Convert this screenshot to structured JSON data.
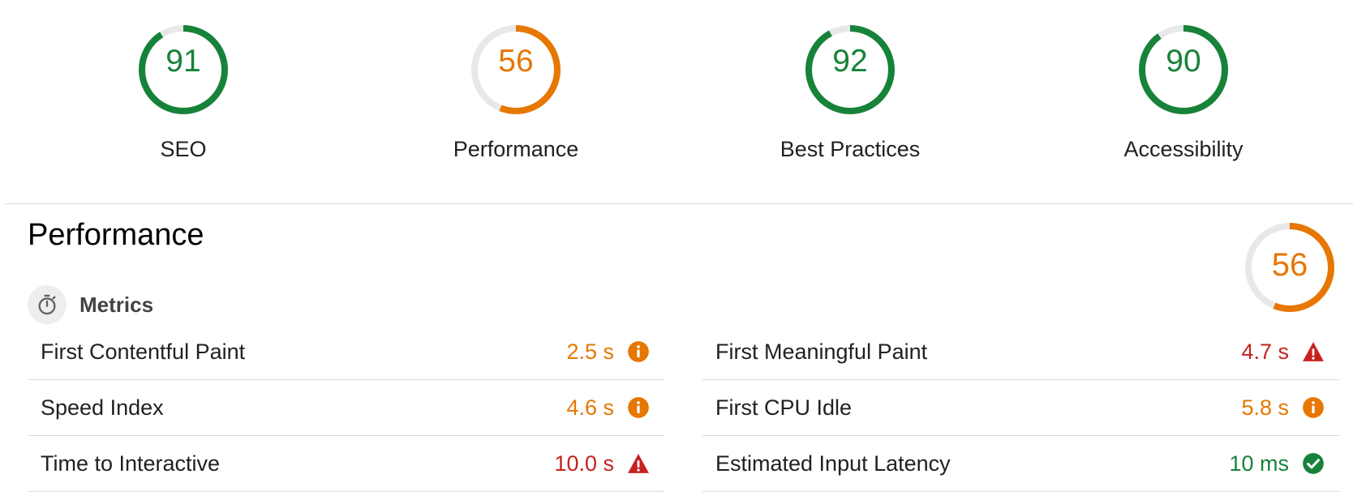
{
  "colors": {
    "pass": "#178239",
    "average": "#e67700",
    "fail": "#c7221f",
    "track": "#e8e8e8"
  },
  "summary_gauges": [
    {
      "label": "SEO",
      "score": "91",
      "fraction": 0.91,
      "status": "pass"
    },
    {
      "label": "Performance",
      "score": "56",
      "fraction": 0.56,
      "status": "average"
    },
    {
      "label": "Best Practices",
      "score": "92",
      "fraction": 0.92,
      "status": "pass"
    },
    {
      "label": "Accessibility",
      "score": "90",
      "fraction": 0.9,
      "status": "pass"
    }
  ],
  "performance": {
    "title": "Performance",
    "score": "56",
    "fraction": 0.56,
    "status": "average",
    "metrics_title": "Metrics",
    "metrics_icon": "stopwatch-icon",
    "metrics": [
      {
        "name": "First Contentful Paint",
        "value": "2.5 s",
        "status": "average",
        "icon": "info-icon"
      },
      {
        "name": "First Meaningful Paint",
        "value": "4.7 s",
        "status": "fail",
        "icon": "warning-triangle-icon"
      },
      {
        "name": "Speed Index",
        "value": "4.6 s",
        "status": "average",
        "icon": "info-icon"
      },
      {
        "name": "First CPU Idle",
        "value": "5.8 s",
        "status": "average",
        "icon": "info-icon"
      },
      {
        "name": "Time to Interactive",
        "value": "10.0 s",
        "status": "fail",
        "icon": "warning-triangle-icon"
      },
      {
        "name": "Estimated Input Latency",
        "value": "10 ms",
        "status": "pass",
        "icon": "check-circle-icon"
      }
    ]
  }
}
